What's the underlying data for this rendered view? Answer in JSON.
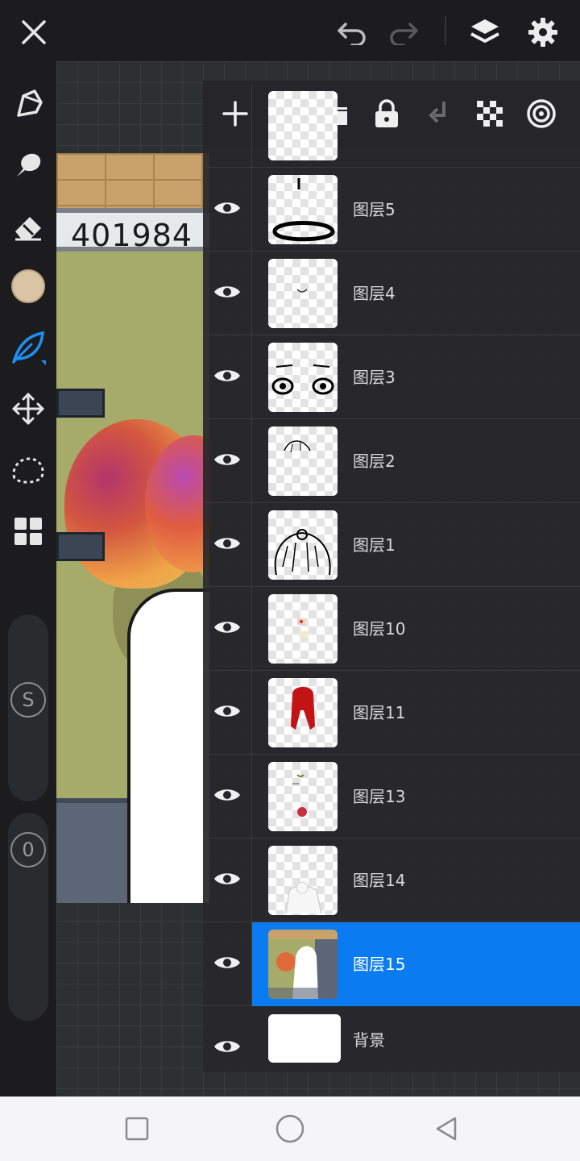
{
  "topbar": {
    "close_icon": "close-icon",
    "undo_icon": "undo-icon",
    "redo_icon": "redo-icon",
    "layers_icon": "layers-icon",
    "settings_icon": "gear-icon"
  },
  "left_tools": [
    "pen-icon",
    "smudge-icon",
    "eraser-icon",
    "color-swatch",
    "leaf-brush-icon",
    "move-icon",
    "lasso-icon",
    "grid-apps-icon"
  ],
  "brush_color": "#d9c4a4",
  "accent": "#0a7bf0",
  "size_slider": {
    "label": "S"
  },
  "opacity_slider": {
    "label": "0"
  },
  "artwork": {
    "sign_text": "401984"
  },
  "panel_tools": [
    "add-layer-icon",
    "folder-icon",
    "lock-icon",
    "merge-down-icon",
    "checker-icon",
    "target-icon"
  ],
  "layers": [
    {
      "name": "图层5"
    },
    {
      "name": "图层4"
    },
    {
      "name": "图层3"
    },
    {
      "name": "图层2"
    },
    {
      "name": "图层1"
    },
    {
      "name": "图层10"
    },
    {
      "name": "图层11"
    },
    {
      "name": "图层13"
    },
    {
      "name": "图层14"
    },
    {
      "name": "图层15",
      "selected": true
    },
    {
      "name": "背景"
    }
  ]
}
